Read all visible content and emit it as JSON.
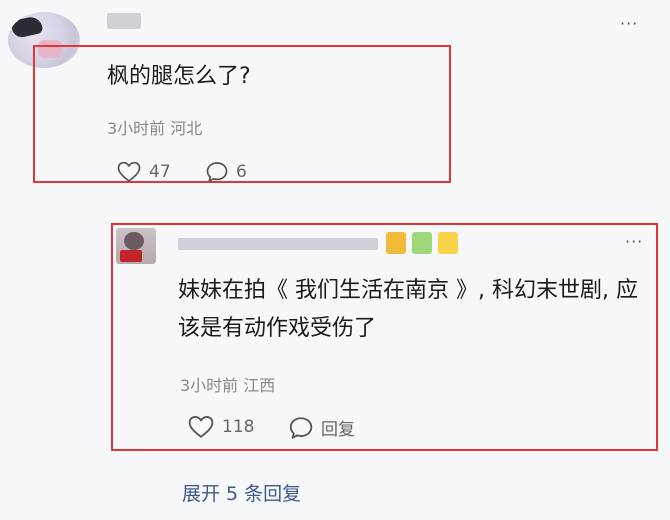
{
  "comment": {
    "question": "枫的腿怎么了?",
    "meta": "3小时前 河北",
    "likes": "47",
    "comments": "6"
  },
  "reply": {
    "text": "妹妹在拍《 我们生活在南京 》, 科幻末世剧, 应该是有动作戏受伤了",
    "meta": "3小时前 江西",
    "likes": "118",
    "reply_label": "回复"
  },
  "expand_label": "展开 5 条回复",
  "icons": {
    "more": "more-dots-icon",
    "like": "heart-outline-icon",
    "comment": "speech-bubble-icon"
  },
  "colors": {
    "highlight_box": "#e0363c",
    "link": "#3e5a8a",
    "meta": "#888888"
  }
}
